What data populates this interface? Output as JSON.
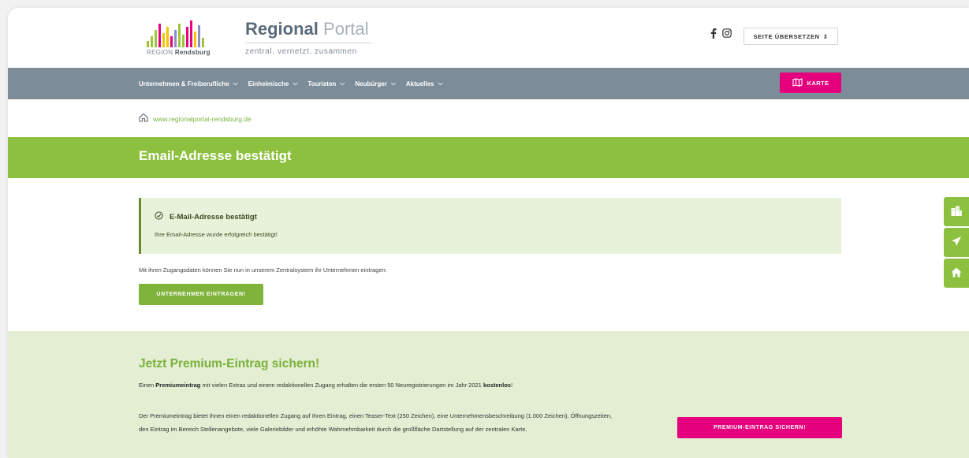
{
  "header": {
    "logo": {
      "title_bold": "Regional",
      "title_light": "Portal",
      "region_prefix": "REGION",
      "region_name": "Rendsburg",
      "tagline": "zentral. vernetzt. zusammen",
      "bar_colors": [
        "#9dc43b",
        "#e5007e",
        "#f4c400",
        "#8b8fc4",
        "#5b6b7c"
      ]
    },
    "social": {
      "facebook_icon": "facebook-icon",
      "instagram_icon": "instagram-icon"
    },
    "translate_label": "SEITE ÜBERSETZEN"
  },
  "nav": {
    "items": [
      {
        "label": "Unternehmen & Freiberufliche"
      },
      {
        "label": "Einheimische"
      },
      {
        "label": "Touristen"
      },
      {
        "label": "Neubürger"
      },
      {
        "label": "Aktuelles"
      }
    ],
    "karte_label": "KARTE"
  },
  "breadcrumb": {
    "url": "www.regionalportal-rendsburg.de"
  },
  "page_title": "Email-Adresse bestätigt",
  "success": {
    "title": "E-Mail-Adresse bestätigt",
    "text": "Ihre Email-Adresse wurde erfolgreich bestätigt!"
  },
  "info_text": "Mit ihren Zugangsdaten können Sie nun in unserem Zentralsystem ihr Unternehmen eintragen:",
  "register_button": "UNTERNEHMEN EINTRAGEN!",
  "premium": {
    "title": "Jetzt Premium-Eintrag sichern!",
    "p1_a": "Einen ",
    "p1_bold": "Premiumeintrag",
    "p1_b": " mit vielen Extras und einem redaktionellen Zugang erhalten die ersten 50 Neuregistrierungen im Jahr 2021 ",
    "p1_bold2": "kostenlos",
    "p1_c": "!",
    "p2": "Der Premiumeintrag bietet Ihnen einen redaktionellen Zugang auf Ihren Eintrag, einen Teaser-Text (250 Zeichen), eine Unternehmensbeschreibung (1.000 Zeichen), Öffnungszeiten, den Eintrag im Bereich Stellenangebote, viele Galeriebilder und erhöhte Wahrnehmbarkeit durch die großfläche Dartstellung auf der zentralen Karte.",
    "button": "PREMIUM-EINTRAG SICHERN!"
  },
  "colors": {
    "nav_bg": "#7c8c98",
    "green": "#8dc03f",
    "magenta": "#e5007e",
    "light_green": "#e3eed3"
  }
}
